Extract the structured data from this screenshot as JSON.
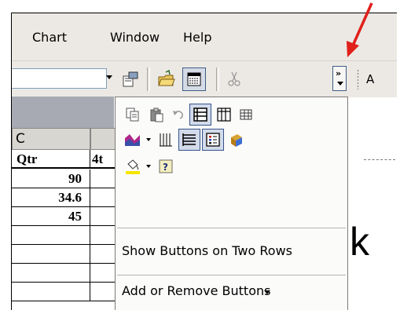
{
  "menubar": {
    "items": [
      {
        "label": "Chart"
      },
      {
        "label": "Window"
      },
      {
        "label": "Help"
      }
    ]
  },
  "toolbar": {
    "font_box_text": "A"
  },
  "sheet": {
    "col_headers": [
      "C",
      ""
    ],
    "header_row": [
      "Qtr",
      "4t"
    ],
    "values": [
      "90",
      "34.6",
      "45"
    ],
    "big_letter": "k"
  },
  "overflow_panel": {
    "show_two_rows": "Show Buttons on Two Rows",
    "add_remove": "Add or Remove Buttons"
  },
  "colors": {
    "accent_arrow": "#e0201b",
    "pressed_border": "#3e5c86",
    "pressed_fill": "#d5dbe6"
  }
}
